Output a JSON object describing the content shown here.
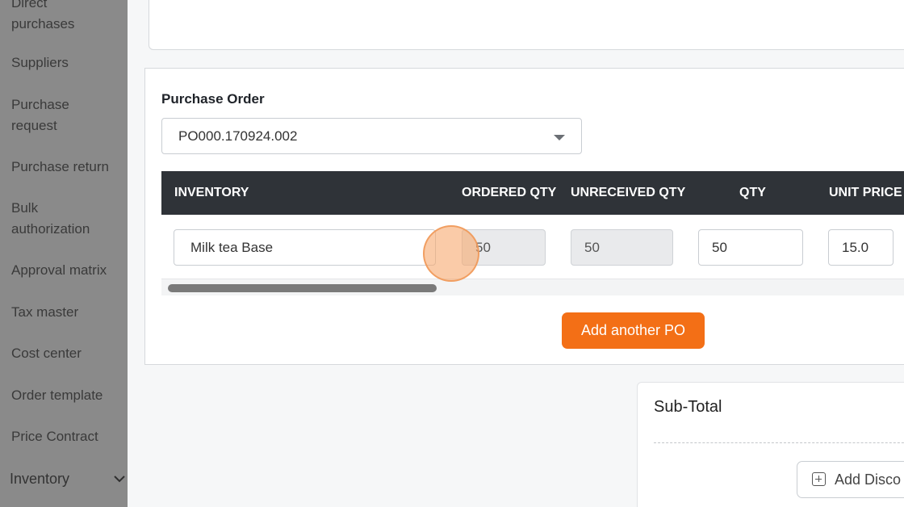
{
  "sidebar": {
    "items": [
      {
        "label": "Direct"
      },
      {
        "label": "purchases"
      },
      {
        "label": "Suppliers"
      },
      {
        "label": "Purchase"
      },
      {
        "label": "request"
      },
      {
        "label": "Purchase return"
      },
      {
        "label": "Bulk"
      },
      {
        "label": "authorization"
      },
      {
        "label": "Approval matrix"
      },
      {
        "label": "Tax master"
      },
      {
        "label": "Cost center"
      },
      {
        "label": "Order template"
      },
      {
        "label": "Price Contract"
      },
      {
        "label": "Inventory"
      }
    ],
    "expand_icon": "chevron-down-icon"
  },
  "purchase_order": {
    "label": "Purchase Order",
    "selected": "PO000.170924.002",
    "table": {
      "columns": [
        "INVENTORY",
        "ORDERED QTY",
        "UNRECEIVED QTY",
        "QTY",
        "UNIT PRICE"
      ],
      "rows": [
        {
          "inventory": "Milk tea Base",
          "ordered_qty": "50",
          "unreceived_qty": "50",
          "qty": "50",
          "unit_price": "15.0"
        }
      ]
    },
    "add_button": "Add another PO"
  },
  "summary": {
    "subtotal_label": "Sub-Total",
    "add_discount_label": "Add Disco"
  },
  "colors": {
    "accent": "#f36f16",
    "table_header": "#2f3338",
    "sidebar_bg": "#8a8a8a"
  }
}
